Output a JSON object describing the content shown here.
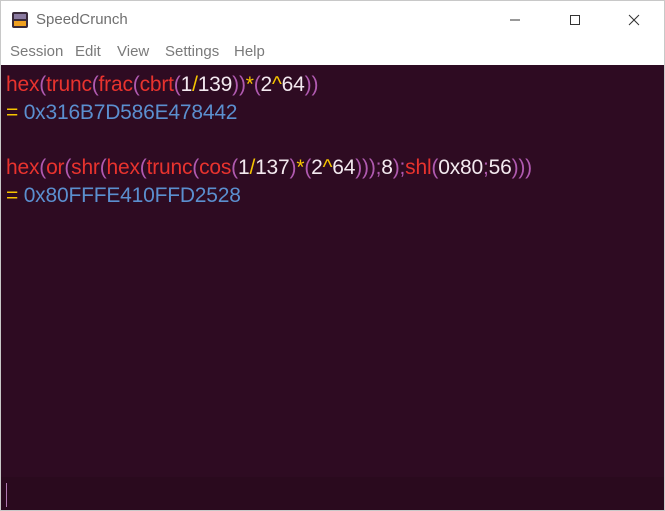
{
  "window": {
    "title": "SpeedCrunch"
  },
  "menu": [
    "Session",
    "Edit",
    "View",
    "Settings",
    "Help"
  ],
  "history": [
    {
      "expression": [
        "hex",
        "(",
        "trunc",
        "(",
        "frac",
        "(",
        "cbrt",
        "(",
        "1",
        "/",
        "139",
        ")",
        ")",
        "*",
        "(",
        "2",
        "^",
        "64",
        ")",
        ")"
      ],
      "result": "0x316B7D586E478442"
    },
    {
      "expression": [
        "hex",
        "(",
        "or",
        "(",
        "shr",
        "(",
        "hex",
        "(",
        "trunc",
        "(",
        "cos",
        "(",
        "1",
        "/",
        "137",
        ")",
        "*",
        "(",
        "2",
        "^",
        "64",
        ")",
        ")",
        ")",
        ";",
        "8",
        ")",
        ";",
        "shl",
        "(",
        "0x80",
        ";",
        "56",
        ")",
        ")",
        ")"
      ],
      "result": "0x80FFFE410FFD2528"
    }
  ],
  "result_prefix": "= ",
  "editor": {
    "value": ""
  }
}
